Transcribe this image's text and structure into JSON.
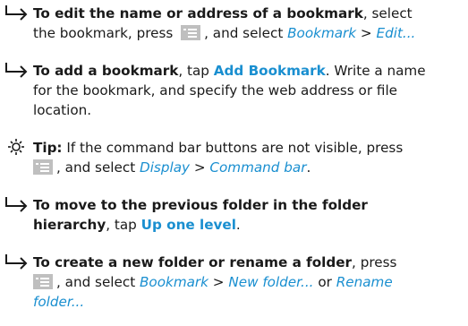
{
  "icons": {
    "step": "arrow-right-hook-icon",
    "tip": "sun-bulb-icon",
    "menu_key": "menu-key-icon"
  },
  "colors": {
    "link": "#1a8fd0",
    "text": "#1a1a1a",
    "key_bg": "#bfbfbf"
  },
  "items": [
    {
      "bold": "To edit the name or address of a bookmark",
      "t1": ", select",
      "t2": "the bookmark, press",
      "t3": ", and select",
      "menu": "Bookmark",
      "sep": ">",
      "cmd": "Edit..."
    },
    {
      "bold": "To add a bookmark",
      "t1": ", tap",
      "action": "Add Bookmark",
      "t2": ". Write a name",
      "t3": "for the bookmark, and specify the web address or file",
      "t4": "location."
    },
    {
      "bold": "Tip:",
      "t1": "If the command bar buttons are not visible, press",
      "t2": ", and select",
      "menu": "Display",
      "sep": ">",
      "cmd": "Command bar",
      "end": "."
    },
    {
      "bold1": "To move to the previous folder in the folder",
      "bold2": "hierarchy",
      "t1": ", tap",
      "action": "Up one level",
      "end": "."
    },
    {
      "bold": "To create a new folder or rename a folder",
      "t1": ", press",
      "t2": ", and select",
      "menu": "Bookmark",
      "sep": ">",
      "cmd1": "New folder...",
      "or": "or",
      "cmd2a": "Rename",
      "cmd2b": "folder..."
    }
  ]
}
